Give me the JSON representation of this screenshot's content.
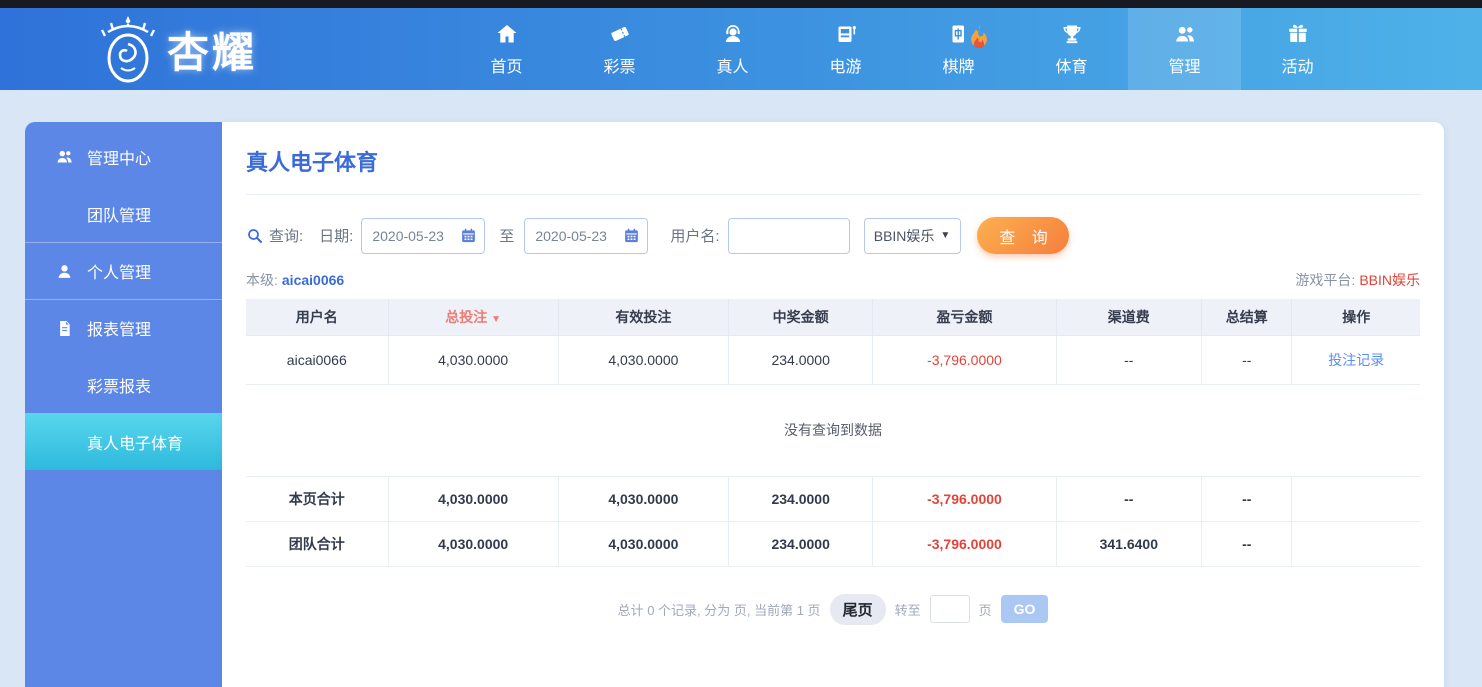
{
  "brand": {
    "name": "杏耀"
  },
  "nav": {
    "items": [
      {
        "label": "首页",
        "icon": "home-icon",
        "active": false
      },
      {
        "label": "彩票",
        "icon": "ticket-icon",
        "active": false
      },
      {
        "label": "真人",
        "icon": "live-dealer-icon",
        "active": false
      },
      {
        "label": "电游",
        "icon": "slot-machine-icon",
        "active": false
      },
      {
        "label": "棋牌",
        "icon": "board-card-icon",
        "badge": "fire-icon",
        "active": false
      },
      {
        "label": "体育",
        "icon": "trophy-icon",
        "active": false
      },
      {
        "label": "管理",
        "icon": "users-icon",
        "active": true
      },
      {
        "label": "活动",
        "icon": "gift-icon",
        "active": false
      }
    ]
  },
  "sidebar": {
    "items": [
      {
        "label": "管理中心",
        "icon": "users-icon"
      },
      {
        "label": "团队管理"
      },
      {
        "label": "个人管理",
        "icon": "user-icon"
      },
      {
        "label": "报表管理",
        "icon": "report-icon"
      },
      {
        "label": "彩票报表"
      },
      {
        "label": "真人电子体育",
        "active": true
      }
    ]
  },
  "main": {
    "title": "真人电子体育",
    "search": {
      "query_label": "查询:",
      "date_label": "日期:",
      "date_from": "2020-05-23",
      "to_label": "至",
      "date_to": "2020-05-23",
      "username_label": "用户名:",
      "username_value": "",
      "platform_selected": "BBIN娱乐",
      "select_arrow": "▼",
      "submit_label": "查 询"
    },
    "level": {
      "label": "本级:",
      "value": "aicai0066"
    },
    "platform": {
      "label": "游戏平台:",
      "value": "BBIN娱乐"
    },
    "table": {
      "columns": [
        "用户名",
        "总投注",
        "有效投注",
        "中奖金额",
        "盈亏金额",
        "渠道费",
        "总结算",
        "操作"
      ],
      "sort_indicator": "▼",
      "rows": [
        [
          "aicai0066",
          "4,030.0000",
          "4,030.0000",
          "234.0000",
          "-3,796.0000",
          "--",
          "--",
          "投注记录"
        ]
      ],
      "empty_message": "没有查询到数据",
      "summary_rows": [
        {
          "label": "本页合计",
          "values": [
            "4,030.0000",
            "4,030.0000",
            "234.0000",
            "-3,796.0000",
            "--",
            "--",
            ""
          ]
        },
        {
          "label": "团队合计",
          "values": [
            "4,030.0000",
            "4,030.0000",
            "234.0000",
            "-3,796.0000",
            "341.6400",
            "--",
            ""
          ]
        }
      ]
    },
    "pagination": {
      "summary": "总计 0 个记录, 分为 页, 当前第 1 页",
      "last_page_label": "尾页",
      "goto_label": "转至",
      "page_unit_label": "页",
      "go_label": "GO"
    }
  },
  "colors": {
    "accent_blue": "#3a6bd8",
    "accent_red": "#e0443a",
    "button_orange": "#f57e3d",
    "sidebar_blue": "#5c87e6",
    "sidebar_active_cyan": "#35c3e0",
    "nav_gradient_start": "#2f72d9",
    "nav_gradient_end": "#4eb2e8"
  }
}
